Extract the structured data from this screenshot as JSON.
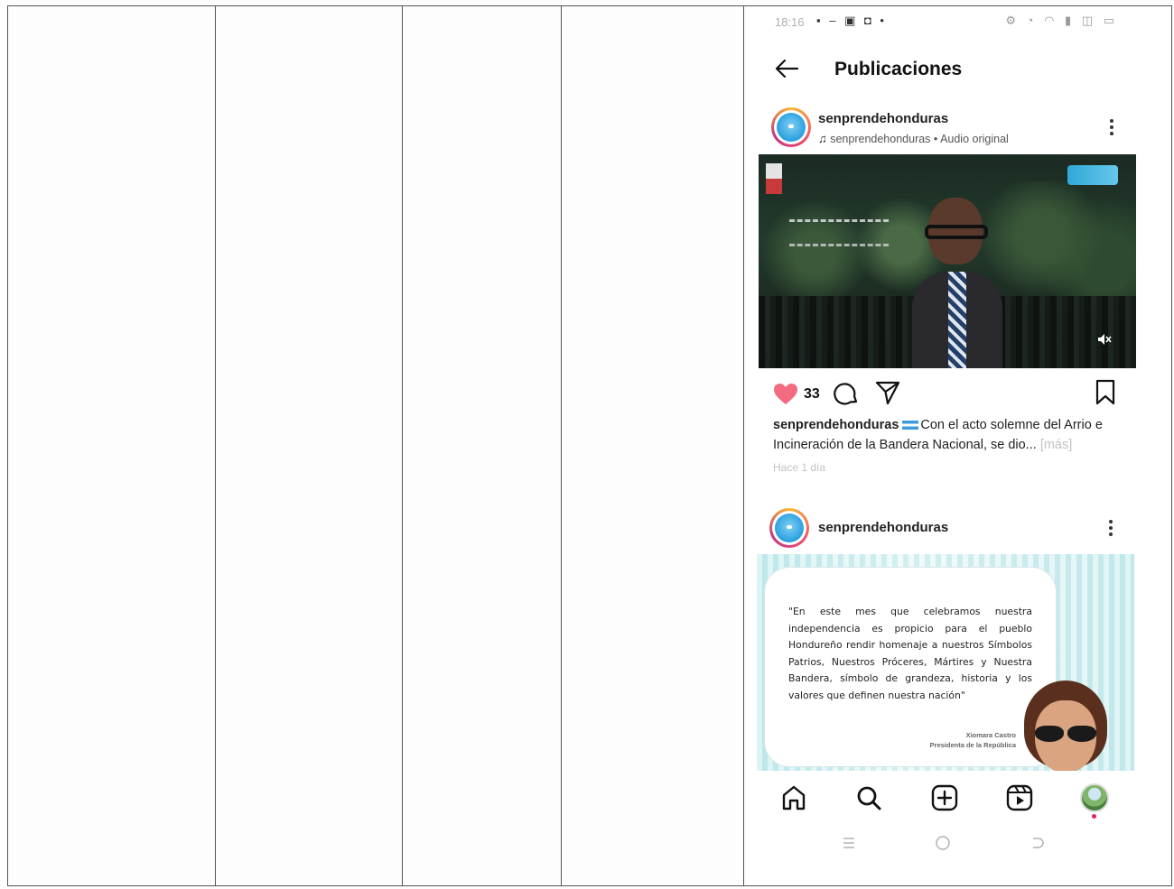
{
  "status_bar": {
    "time": "18:16",
    "left_glyphs": "▪ – ▣ ◘ •",
    "right_glyphs": "⚙ ◔ ◠ ▮ ◫ ▭"
  },
  "header": {
    "title": "Publicaciones"
  },
  "post1": {
    "username": "senprendehonduras",
    "audio": "senprendehonduras • Audio original",
    "like_count": "33",
    "caption_user": "senprendehonduras",
    "caption_text": "Con el acto solemne del Arrio e Incineración de la Bandera Nacional, se dio...",
    "more_label": "[más]",
    "time": "Hace 1 día"
  },
  "post2": {
    "username": "senprendehonduras",
    "quote": "\"En este mes que celebramos nuestra independencia es propicio para el pueblo Hondureño rendir homenaje a nuestros Símbolos Patrios, Nuestros Próceres, Mártires y Nuestra Bandera, símbolo de grandeza, historia y los valores que definen nuestra nación\"",
    "sign_name": "Xiomara Castro",
    "sign_role": "Presidenta de la República"
  },
  "colors": {
    "like": "#f26b80",
    "text": "#111111",
    "muted": "#c4c4c4",
    "table_lines": "#555555"
  }
}
